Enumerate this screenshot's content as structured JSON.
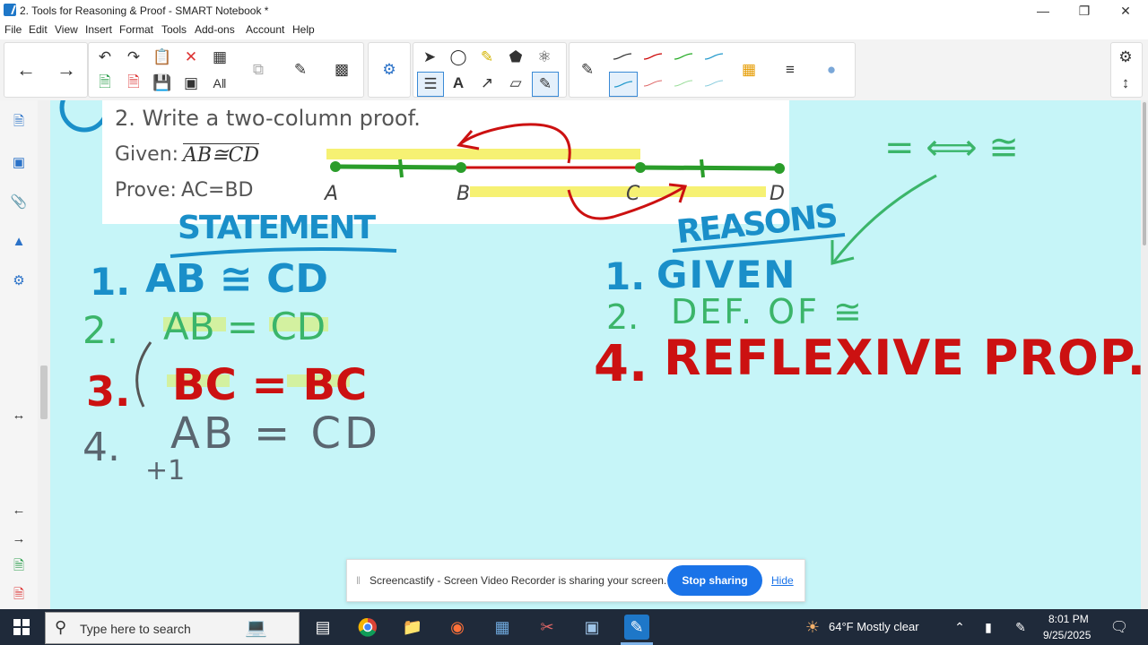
{
  "window": {
    "title": "2. Tools for Reasoning & Proof - SMART Notebook *",
    "minimize_icon": "minimize-icon",
    "restore_icon": "restore-icon",
    "close_icon": "close-icon"
  },
  "menu": [
    "File",
    "Edit",
    "View",
    "Insert",
    "Format",
    "Tools",
    "Add-ons",
    "Account",
    "Help"
  ],
  "problem": {
    "title": "2. Write a two-column proof.",
    "given_label": "Given:",
    "given_stmt": "AB≅CD",
    "prove_label": "Prove:",
    "prove_stmt": "AC=BD",
    "points": [
      "A",
      "B",
      "C",
      "D"
    ]
  },
  "handwriting": {
    "statement_header": "STATEMENT",
    "reasons_header": "REASONS",
    "statements": [
      {
        "num": "1.",
        "text": "AB ≅ CD",
        "color": "#1a8fc9"
      },
      {
        "num": "2.",
        "text": "AB = CD",
        "color": "#3bb56a"
      },
      {
        "num": "3.",
        "text": "BC = BC",
        "color": "#cc1111"
      },
      {
        "num": "4.",
        "text": "AB = CD",
        "color": "#5a6670"
      }
    ],
    "plus_sign": "+1",
    "reasons": [
      {
        "num": "1.",
        "text": "GIVEN",
        "color": "#1a8fc9"
      },
      {
        "num": "2.",
        "text": "DEF. OF ≅",
        "color": "#3bb56a"
      },
      {
        "num": "4.",
        "text": "REFLEXIVE PROP.",
        "color": "#cc1111"
      }
    ],
    "note": "= ⟺ ≅"
  },
  "screen_share": {
    "message": "Screencastify - Screen Video Recorder is sharing your screen.",
    "stop_label": "Stop sharing",
    "hide_label": "Hide"
  },
  "taskbar": {
    "search_placeholder": "Type here to search",
    "weather": "64°F  Mostly clear",
    "time": "8:01 PM",
    "date": "9/25/2025"
  },
  "colors": {
    "canvas": "#c6f5f8",
    "accent": "#1a73e8",
    "ink_blue": "#1a8fc9",
    "ink_green": "#3bb56a",
    "ink_red": "#cc1111",
    "ink_gray": "#5a6670"
  }
}
